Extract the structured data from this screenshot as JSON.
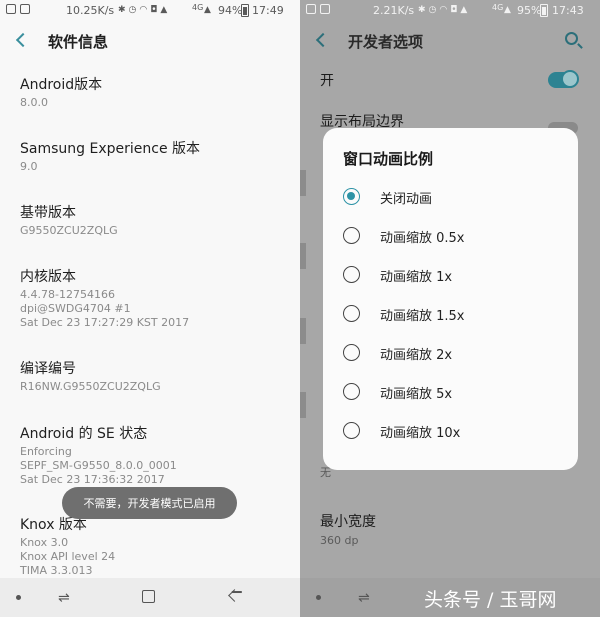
{
  "left": {
    "status": {
      "speed": "10.25K/s",
      "net": "4G",
      "battery": "94%",
      "time": "17:49"
    },
    "title": "软件信息",
    "items": [
      {
        "title": "Android版本",
        "lines": [
          "8.0.0"
        ]
      },
      {
        "title": "Samsung Experience 版本",
        "lines": [
          "9.0"
        ]
      },
      {
        "title": "基带版本",
        "lines": [
          "G9550ZCU2ZQLG"
        ]
      },
      {
        "title": "内核版本",
        "lines": [
          "4.4.78-12754166",
          "dpi@SWDG4704 #1",
          "Sat Dec 23 17:27:29 KST 2017"
        ]
      },
      {
        "title": "编译编号",
        "lines": [
          "R16NW.G9550ZCU2ZQLG"
        ]
      },
      {
        "title": "Android 的 SE 状态",
        "lines": [
          "Enforcing",
          "SEPF_SM-G9550_8.0.0_0001",
          "Sat Dec 23 17:36:32 2017"
        ]
      },
      {
        "title": "Knox 版本",
        "lines": [
          "Knox 3.0",
          "Knox API level 24",
          "TIMA 3.3.013"
        ]
      }
    ],
    "toast": "不需要，开发者模式已启用"
  },
  "right": {
    "status": {
      "speed": "2.21K/s",
      "net": "4G",
      "battery": "95%",
      "time": "17:43"
    },
    "title": "开发者选项",
    "master_label": "开",
    "show_layout_label": "显示布局边界",
    "none_value": "无",
    "min_width": {
      "title": "最小宽度",
      "value": "360 dp"
    },
    "dialog": {
      "title": "窗口动画比例",
      "options": [
        "关闭动画",
        "动画缩放 0.5x",
        "动画缩放 1x",
        "动画缩放 1.5x",
        "动画缩放 2x",
        "动画缩放 5x",
        "动画缩放 10x"
      ],
      "selected_index": 0
    }
  },
  "watermark": "头条号 / 玉哥网",
  "colors": {
    "accent": "#2d93a6",
    "toggle_on": "#2d8392"
  }
}
